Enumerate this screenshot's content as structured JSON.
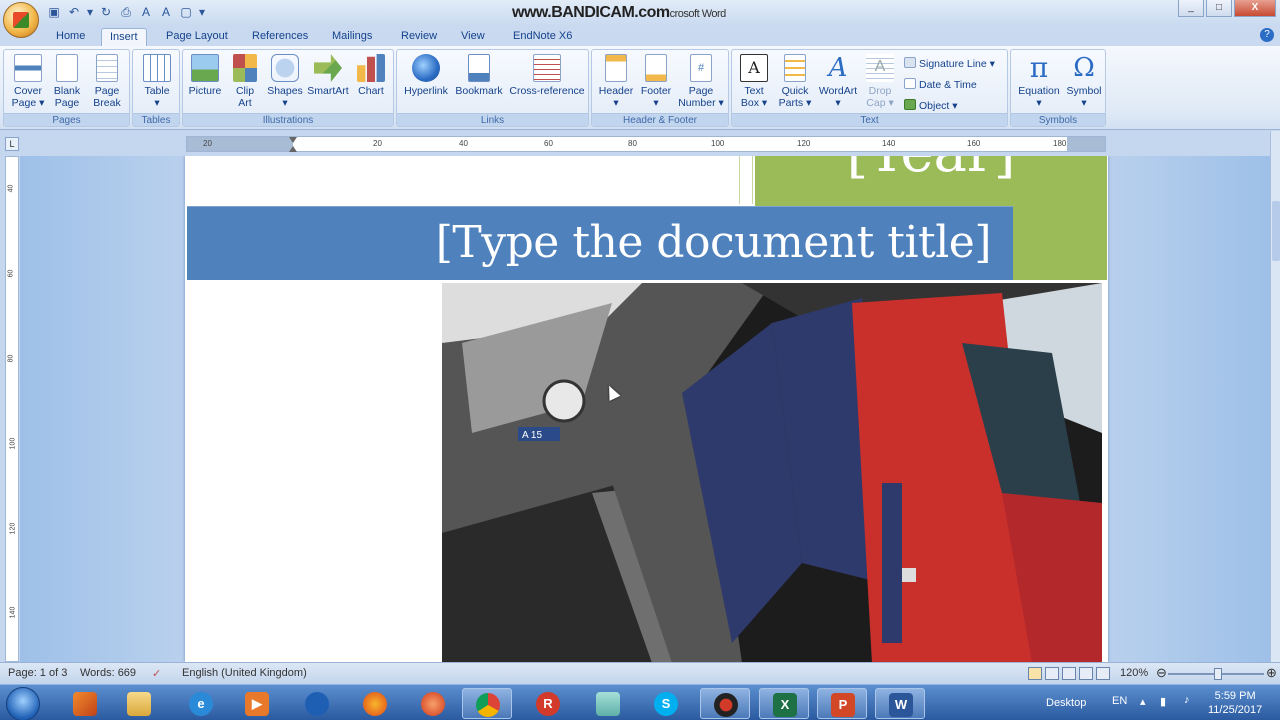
{
  "window": {
    "title_overlay": "www.BANDICAM.com",
    "title_suffix": "crosoft Word",
    "controls": [
      "_",
      "□",
      "X"
    ]
  },
  "quick_access": [
    "save-icon",
    "undo-icon",
    "redo-icon",
    "print-preview-icon",
    "font-icon",
    "font-color-icon",
    "frame-icon",
    "customize-icon"
  ],
  "tabs": [
    {
      "label": "Home",
      "active": false
    },
    {
      "label": "Insert",
      "active": true
    },
    {
      "label": "Page Layout",
      "active": false
    },
    {
      "label": "References",
      "active": false
    },
    {
      "label": "Mailings",
      "active": false
    },
    {
      "label": "Review",
      "active": false
    },
    {
      "label": "View",
      "active": false
    },
    {
      "label": "EndNote X6",
      "active": false
    }
  ],
  "ribbon": {
    "groups": {
      "pages": {
        "label": "Pages",
        "buttons": [
          "Cover\nPage ▾",
          "Blank\nPage",
          "Page\nBreak"
        ]
      },
      "tables": {
        "label": "Tables",
        "buttons": [
          "Table\n▾"
        ]
      },
      "illustrations": {
        "label": "Illustrations",
        "buttons": [
          "Picture",
          "Clip\nArt",
          "Shapes\n▾",
          "SmartArt",
          "Chart"
        ]
      },
      "links": {
        "label": "Links",
        "buttons": [
          "Hyperlink",
          "Bookmark",
          "Cross-reference"
        ]
      },
      "header_footer": {
        "label": "Header & Footer",
        "buttons": [
          "Header\n▾",
          "Footer\n▾",
          "Page\nNumber ▾"
        ]
      },
      "text": {
        "label": "Text",
        "buttons": [
          "Text\nBox ▾",
          "Quick\nParts ▾",
          "WordArt\n▾",
          "Drop\nCap ▾"
        ],
        "small": [
          "Signature Line ▾",
          "Date & Time",
          "Object ▾"
        ]
      },
      "symbols": {
        "label": "Symbols",
        "buttons": [
          "Equation\n▾",
          "Symbol\n▾"
        ]
      }
    }
  },
  "ruler": {
    "h_ticks": [
      "20",
      "20",
      "40",
      "60",
      "80",
      "100",
      "120",
      "140",
      "160",
      "180"
    ],
    "v_ticks": [
      "40",
      "60",
      "80",
      "100",
      "120",
      "140"
    ],
    "corner": "L"
  },
  "document": {
    "year_placeholder": "[Year]",
    "title_placeholder": "[Type the document title]",
    "colors": {
      "green": "#9bbb59",
      "blue": "#4f81bd"
    },
    "photo": "train-at-station-image"
  },
  "status": {
    "page": "Page: 1 of 3",
    "words": "Words: 669",
    "language": "English (United Kingdom)",
    "zoom": "120%"
  },
  "taskbar": {
    "apps": [
      "matlab-icon",
      "file-explorer-icon",
      "internet-explorer-icon",
      "media-player-icon",
      "app-icon",
      "firefox-icon",
      "firefox-dev-icon",
      "chrome-icon",
      "app-r-icon",
      "folder-icon",
      "skype-icon",
      "recorder-icon",
      "excel-icon",
      "powerpoint-icon",
      "word-icon"
    ],
    "tray_label": "Desktop",
    "lang": "EN",
    "time": "5:59 PM",
    "date": "11/25/2017"
  }
}
